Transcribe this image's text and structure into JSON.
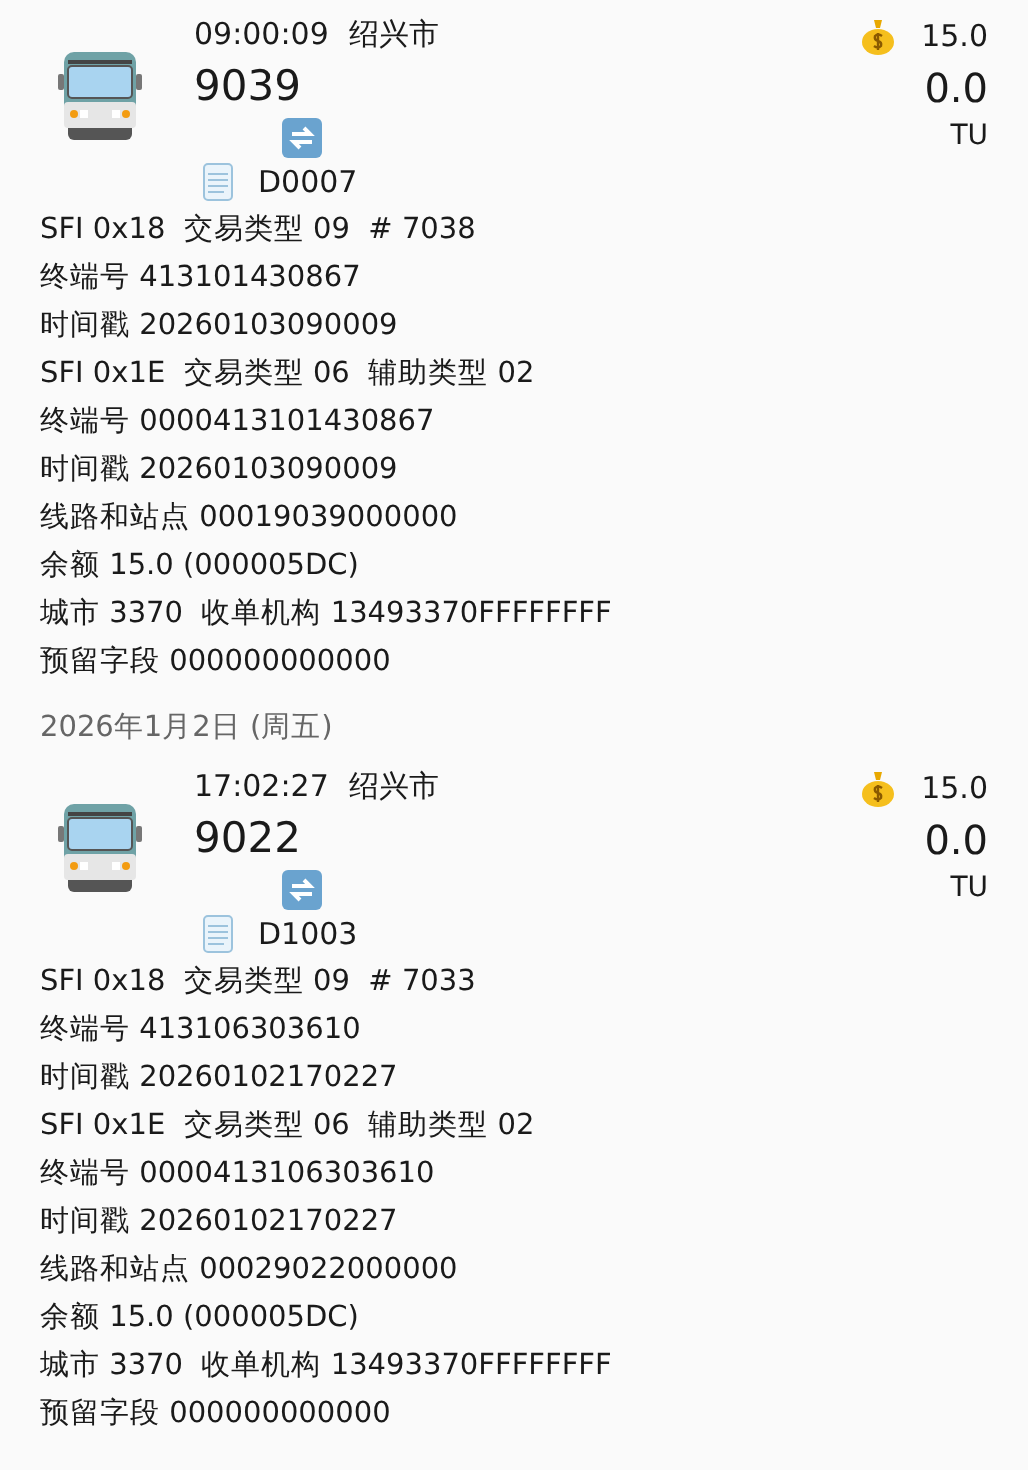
{
  "items": [
    {
      "kind": "record",
      "time": "09:00:09",
      "city": "绍兴市",
      "route": "9039",
      "balance": "15.0",
      "amount": "0.0",
      "unit": "TU",
      "device": "D0007",
      "lines": [
        "SFI 0x18  交易类型 09  # 7038",
        "终端号 413101430867",
        "时间戳 20260103090009",
        "SFI 0x1E  交易类型 06  辅助类型 02",
        "终端号 0000413101430867",
        "时间戳 20260103090009",
        "线路和站点 00019039000000",
        "余额 15.0 (000005DC)",
        "城市 3370  收单机构 13493370FFFFFFFF",
        "预留字段 000000000000"
      ]
    },
    {
      "kind": "date",
      "text": "2026年1月2日 (周五)"
    },
    {
      "kind": "record",
      "time": "17:02:27",
      "city": "绍兴市",
      "route": "9022",
      "balance": "15.0",
      "amount": "0.0",
      "unit": "TU",
      "device": "D1003",
      "lines": [
        "SFI 0x18  交易类型 09  # 7033",
        "终端号 413106303610",
        "时间戳 20260102170227",
        "SFI 0x1E  交易类型 06  辅助类型 02",
        "终端号 0000413106303610",
        "时间戳 20260102170227",
        "线路和站点 00029022000000",
        "余额 15.0 (000005DC)",
        "城市 3370  收单机构 13493370FFFFFFFF",
        "预留字段 000000000000"
      ]
    }
  ]
}
